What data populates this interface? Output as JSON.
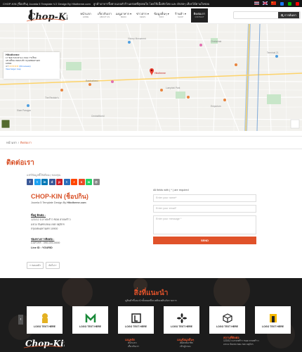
{
  "topbar": {
    "left_text": "CHOP-KIN (ช็อปกิน) Joomla 5 Template V.2 Design By Hitotheme.com",
    "center_text": "ลูกค้าอาหารปิ้งย่างแบบตัวร้านอร่อยที่สุดพอใจ โดยใช้เนื้อสัตว์สด และ ผักสดๆ เลือกได้ตามใจชอบ"
  },
  "header": {
    "logo_text": "Chop-Kin",
    "nav": [
      {
        "label": "หน้าแรก",
        "sub": "HOME"
      },
      {
        "label": "เกี่ยวกับเรา",
        "sub": "ABOUT US"
      },
      {
        "label": "เมนูอาหาร ▾",
        "sub": "MENU"
      },
      {
        "label": "ข่าวสาร ▾",
        "sub": "NEWS"
      },
      {
        "label": "ข้อมูลอื่นๆ ▾",
        "sub": "INFO"
      },
      {
        "label": "ร้านค้า ▾",
        "sub": "SHOP"
      },
      {
        "label": "ติดต่อเรา",
        "sub": "CONTACT"
      }
    ],
    "search_placeholder": "",
    "search_button": "การค้นหา"
  },
  "map": {
    "card_title": "Hitotheme",
    "card_line1": "17 ซอย ซ.สะพาน 1 ถนน 7 ซ.สีลม",
    "card_line2": "แขวงสีลม เขตบางรัก กรุงเทพมหานคร",
    "card_line3": "10500",
    "card_rating": "4.7",
    "card_reviews": "(60 reviews)",
    "card_link": "View larger map",
    "pin_label": "Hitotheme",
    "places": [
      "Terminal 21 Asok",
      "CentralWorld",
      "Siam Paragon",
      "Lumphini Park",
      "Chatuchak",
      "Emporium",
      "The Siam",
      "Victory Monument",
      "Ratchathewi"
    ]
  },
  "breadcrumb": {
    "home": "หน้าแรก",
    "sep": "/",
    "current": "ติดต่อเรา"
  },
  "page": {
    "title": "ติดต่อเรา",
    "share_label": "แชร์ข้อมูลนี้ให้เพื่อนๆ ของคุณ"
  },
  "contact": {
    "company": "CHOP-KIN (ช็อปกิน)",
    "company_sub_a": "Joomla 5 Template Design By ",
    "company_sub_b": "Hitotheme.com",
    "address_label": "ที่อยู่ ติดต่อ :",
    "address_lines": [
      "123/12 ถ.ลาดพร้าว ซอย ลาดพร้าว",
      "แขวง จันทรเกษม เขต จตุจักร",
      "กรุงเทพมหานคร 10900"
    ],
    "phone_label": "ช่องทางการติดต่อ :",
    "phone": "เบอร์โทร : 090-000-0000",
    "line": "Line ID : YOURID"
  },
  "form": {
    "required_label": "All fields with ( * ) are required",
    "name_placeholder": "Enter your name*",
    "email_placeholder": "Enter your email*",
    "message_placeholder": "Enter your message *",
    "send_button": "SEND"
  },
  "pager": {
    "prev": "« ก่อนหน้า",
    "next": "ถัดไป »"
  },
  "footer": {
    "rec_title": "สิ่งที่แนะนำ",
    "rec_sub": "ดูสินค้าที่แนะนำทั้งหมดที่จะเพลิดเพลินกับรายการ",
    "logo_items": [
      "LOGO TEXT HERE",
      "LOGO TEXT HERE",
      "LOGO TEXT HERE",
      "LOGO TEXT HERE",
      "LOGO TEXT HERE",
      "LOGO TEXT HERE"
    ],
    "col1_title": "เมนูหลัก",
    "col1_items": [
      "หน้าแรก",
      "เกี่ยวกับเรา"
    ],
    "col2_title": "เมนูข้อมูลอื่นๆ",
    "col2_items": [
      "สมัครสมาชิก",
      "เข้าสู่ระบบ"
    ],
    "col3_title": "สถานที่ติดต่อ",
    "col3_items": [
      "123/12 ถ.ลาดพร้าว ซอย ลาดพร้าว",
      "แขวง จันทรเกษม เขต จตุจักร"
    ]
  },
  "colors": {
    "accent": "#d9532a",
    "dark": "#1c1c1c"
  }
}
